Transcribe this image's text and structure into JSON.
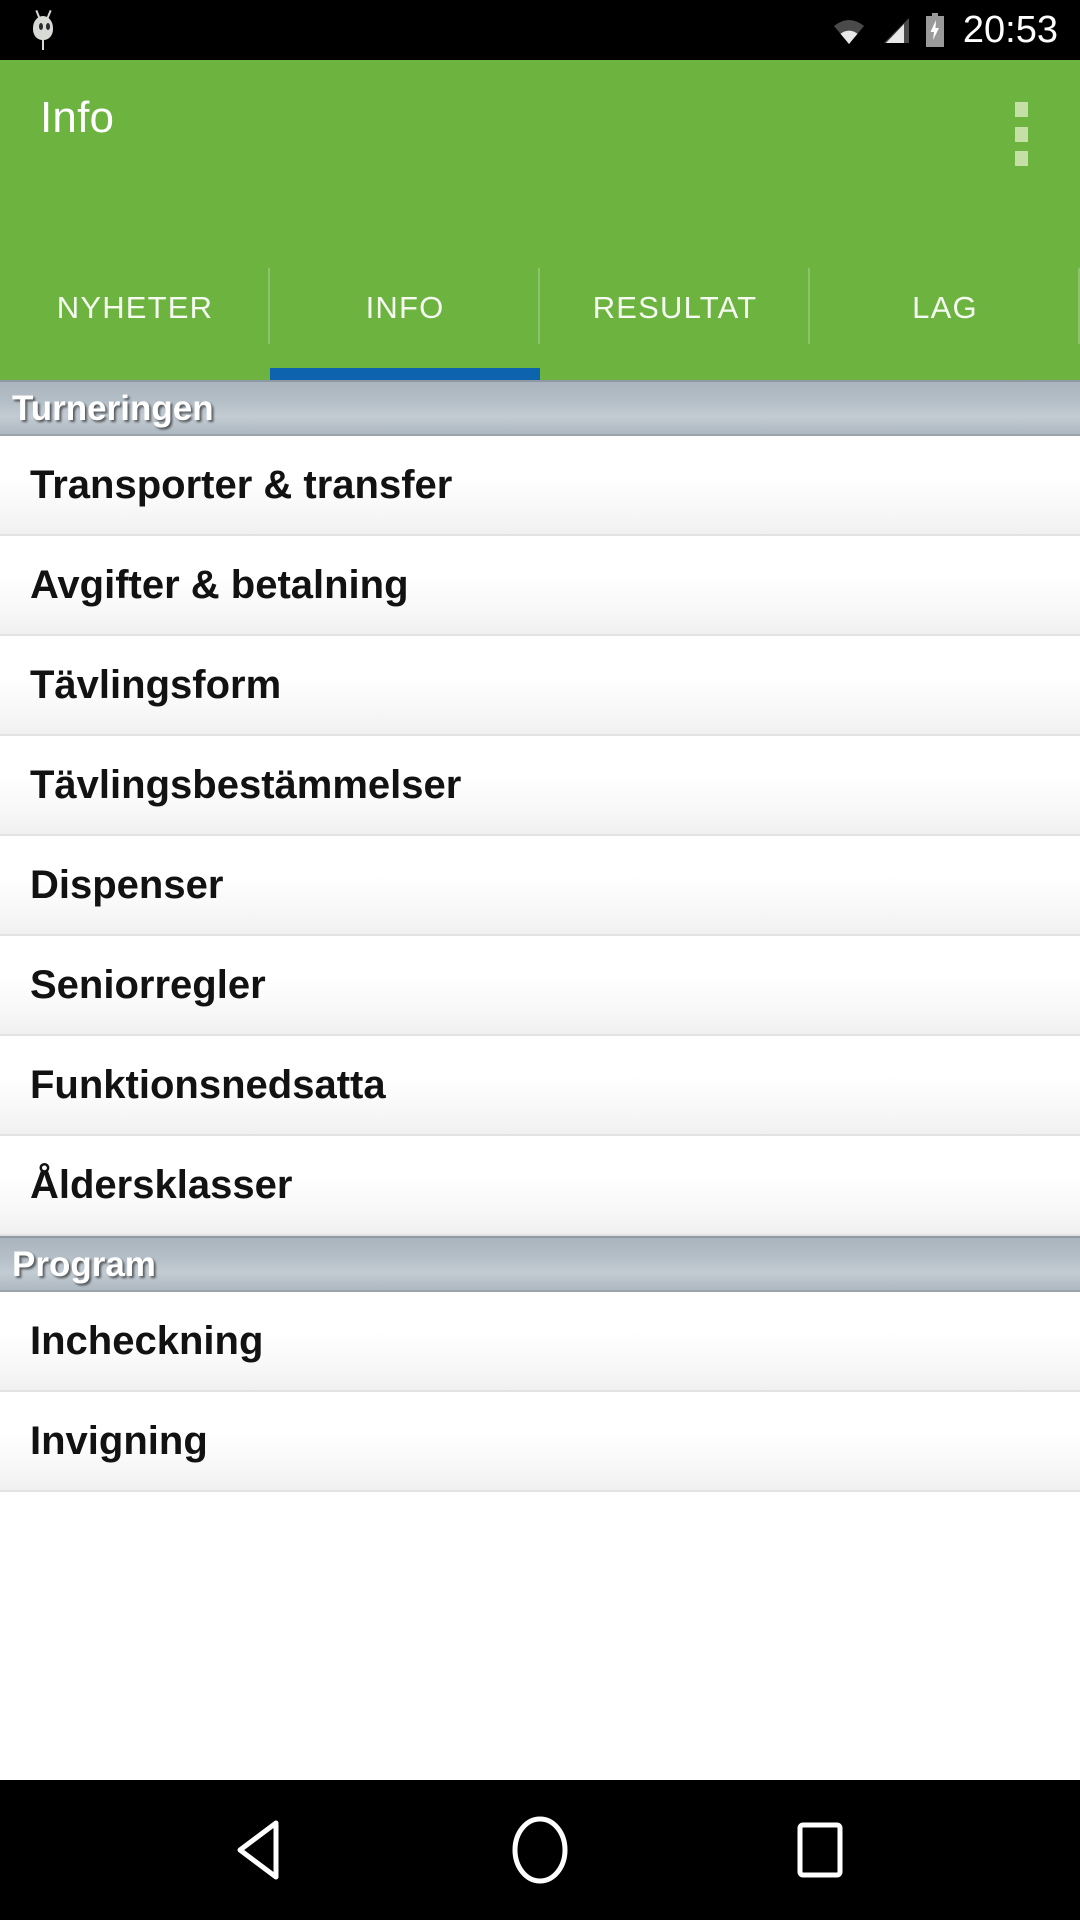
{
  "status_bar": {
    "notification_icon": "bug-icon",
    "wifi_icon": "wifi-icon",
    "signal_icon": "signal-icon",
    "battery_icon": "battery-charging-icon",
    "time": "20:53"
  },
  "app_bar": {
    "title": "Info",
    "overflow_icon": "overflow-menu-icon",
    "background_color": "#6db33f"
  },
  "tabs": {
    "active_index": 1,
    "indicator_color": "#0d63ad",
    "items": [
      {
        "label": "NYHETER"
      },
      {
        "label": "INFO"
      },
      {
        "label": "RESULTAT"
      },
      {
        "label": "LAG"
      }
    ]
  },
  "list": {
    "sections": [
      {
        "header": "Turneringen",
        "items": [
          {
            "label": "Transporter & transfer"
          },
          {
            "label": "Avgifter & betalning"
          },
          {
            "label": "Tävlingsform"
          },
          {
            "label": "Tävlingsbestämmelser"
          },
          {
            "label": "Dispenser"
          },
          {
            "label": "Seniorregler"
          },
          {
            "label": "Funktionsnedsatta"
          },
          {
            "label": "Åldersklasser"
          }
        ]
      },
      {
        "header": "Program",
        "items": [
          {
            "label": "Incheckning"
          },
          {
            "label": "Invigning"
          }
        ]
      }
    ]
  },
  "nav_bar": {
    "back_icon": "back-triangle-icon",
    "home_icon": "home-circle-icon",
    "recents_icon": "recents-square-icon"
  }
}
